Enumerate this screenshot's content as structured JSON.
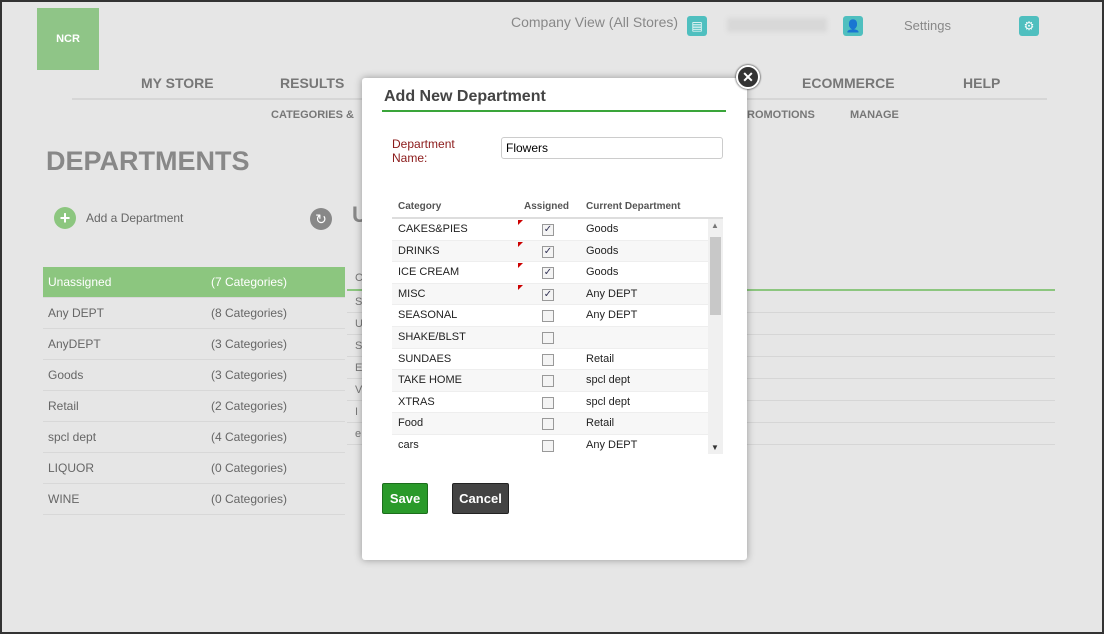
{
  "header": {
    "logo": "NCR",
    "company_view": "Company View (All Stores)",
    "settings": "Settings"
  },
  "nav": [
    "MY STORE",
    "RESULTS",
    "ECOMMERCE",
    "HELP"
  ],
  "subnav": [
    "CATEGORIES &",
    "ROMOTIONS",
    "MANAGE"
  ],
  "page": {
    "title": "DEPARTMENTS",
    "add_label": "Add a Department",
    "partial_heading": "U"
  },
  "departments": [
    {
      "name": "Unassigned",
      "count": "(7 Categories)"
    },
    {
      "name": "Any DEPT",
      "count": "(8 Categories)"
    },
    {
      "name": "AnyDEPT",
      "count": "(3 Categories)"
    },
    {
      "name": "Goods",
      "count": "(3 Categories)"
    },
    {
      "name": "Retail",
      "count": "(2 Categories)"
    },
    {
      "name": "spcl dept",
      "count": "(4 Categories)"
    },
    {
      "name": "LIQUOR",
      "count": "(0 Categories)"
    },
    {
      "name": "WINE",
      "count": "(0 Categories)"
    }
  ],
  "right_rows": [
    "C",
    "S",
    "U",
    "S",
    "E",
    "V",
    "I",
    "e"
  ],
  "modal": {
    "title": "Add New Department",
    "name_label": "Department Name:",
    "name_value": "Flowers",
    "columns": [
      "Category",
      "Assigned",
      "Current Department"
    ],
    "rows": [
      {
        "category": "CAKES&PIES",
        "assigned": true,
        "dept": "Goods"
      },
      {
        "category": "DRINKS",
        "assigned": true,
        "dept": "Goods"
      },
      {
        "category": "ICE CREAM",
        "assigned": true,
        "dept": "Goods"
      },
      {
        "category": "MISC",
        "assigned": true,
        "dept": "Any DEPT"
      },
      {
        "category": "SEASONAL",
        "assigned": false,
        "dept": "Any DEPT"
      },
      {
        "category": "SHAKE/BLST",
        "assigned": false,
        "dept": ""
      },
      {
        "category": "SUNDAES",
        "assigned": false,
        "dept": "Retail"
      },
      {
        "category": "TAKE HOME",
        "assigned": false,
        "dept": "spcl dept"
      },
      {
        "category": "XTRAS",
        "assigned": false,
        "dept": "spcl dept"
      },
      {
        "category": "Food",
        "assigned": false,
        "dept": "Retail"
      },
      {
        "category": "cars",
        "assigned": false,
        "dept": "Any DEPT"
      }
    ],
    "save": "Save",
    "cancel": "Cancel"
  },
  "colors": {
    "accent": "#8cc67f",
    "teal": "#4fbfbf",
    "save": "#2a9a2a"
  }
}
